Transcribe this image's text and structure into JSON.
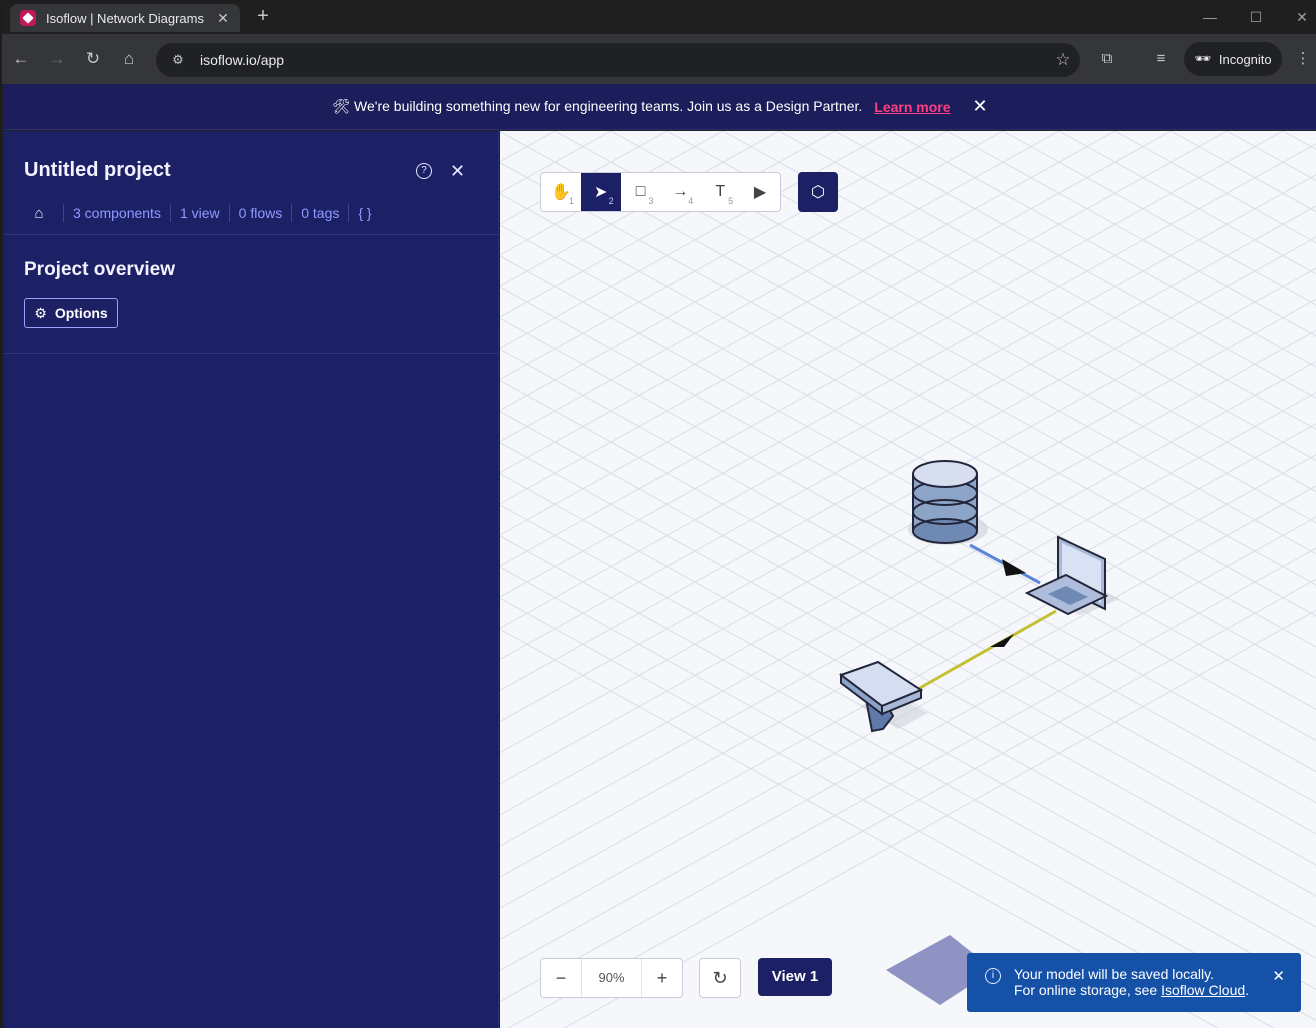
{
  "browser": {
    "tab_title": "Isoflow | Network Diagrams",
    "tab_close": "✕",
    "new_tab": "+",
    "url": "isoflow.io/app",
    "incognito_label": "Incognito"
  },
  "banner": {
    "message": "🛠 We're building something new for engineering teams. Join us as a Design Partner.",
    "link": "Learn more",
    "close": "✕"
  },
  "sidebar": {
    "project_title": "Untitled project",
    "help": "?",
    "close": "✕",
    "breadcrumbs": {
      "components": "3 components",
      "views": "1 view",
      "flows": "0 flows",
      "tags": "0 tags",
      "json": "{ }"
    },
    "section_title": "Project overview",
    "options_label": "Options"
  },
  "canvas": {
    "tools": [
      {
        "name": "pan",
        "glyph": "✋",
        "num": "1"
      },
      {
        "name": "select",
        "glyph": "➤",
        "num": "2"
      },
      {
        "name": "rectangle",
        "glyph": "□",
        "num": "3"
      },
      {
        "name": "connector",
        "glyph": "→",
        "num": "4"
      },
      {
        "name": "text",
        "glyph": "T",
        "num": "5"
      },
      {
        "name": "present",
        "glyph": "▶",
        "num": ""
      }
    ],
    "zoom_value": "90%",
    "zoom_out": "−",
    "zoom_in": "+",
    "reset": "↻",
    "view_label": "View 1",
    "connector_colors": {
      "database_laptop": "#5b86d6",
      "desk_laptop": "#c4c034"
    }
  },
  "toast": {
    "line1": "Your model will be saved locally.",
    "line2": "For online storage, see",
    "link": "Isoflow Cloud",
    "end": ".",
    "close": "✕"
  }
}
